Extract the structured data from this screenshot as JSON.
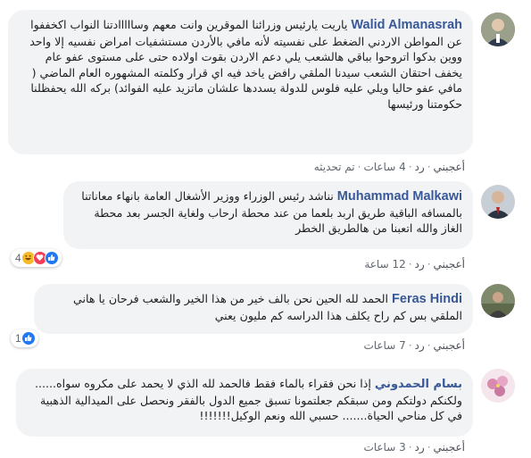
{
  "comments": [
    {
      "author": "Walid Almanasrah",
      "text": "ياريت يارئيس وزرائنا الموقرين وانت معهم وسااااادتنا النواب اكخففوا عن المواطن الاردني الضغط على نفسيته لأنه مافي بالأردن مستشفيات امراض نفسيه إلا واحد ووين بدكوا اتروحوا بباقي هالشعب يلي دعم الاردن بقوت اولاده حتى على مستوى عفو عام يخفف احتقان الشعب سيدنا الملقي رافض ياخد فيه اي قرار وكلمته المشهوره العام الماضي ( مافي عفو حاليا ويلي عليه فلوس للدولة يسددها علشان ماتزيد عليه الفوائد) بركه الله يحفظلنا حكومتنا ورئيسها",
      "like": "أعجبني",
      "reply": "رد",
      "time": "4 ساعات",
      "edited": "تم تحديثه"
    },
    {
      "author": "Muhammad Malkawi",
      "text": "نناشد رئيس الوزراء ووزير الأشغال العامة بانهاء معاناتنا بالمسافه الباقية طريق اربد بلعما من عند محطة ارحاب ولغاية الجسر بعد محطة الغاز والله اتعبنا من هالطريق الخطر",
      "like": "أعجبني",
      "reply": "رد",
      "time": "12 ساعة",
      "reactions_count": "4"
    },
    {
      "author": "Feras Hindi",
      "text": "الحمد لله الحين نحن بالف خير من هذا الخير والشعب فرحان يا هاني الملقي بس كم راح يكلف هذا الدراسه كم مليون يعني",
      "like": "أعجبني",
      "reply": "رد",
      "time": "7 ساعات",
      "reactions_count": "1"
    },
    {
      "author": "بسام الحمدوني",
      "text": "إذا نحن فقراء بالماء فقط فالحمد لله الذي لا يحمد على مكروه سواه...... ولكنكم دولتكم ومن سبقكم جعلتمونا تسبق جميع الدول بالفقر ونحصل على الميدالية الذهبية في كل مناحي الحياة....... حسبي الله ونعم الوكيل!!!!!!!",
      "like": "أعجبني",
      "reply": "رد",
      "time": "3 ساعات"
    }
  ],
  "colors": {
    "link": "#385898",
    "bubble": "#f2f3f5",
    "like_blue": "#2078f4",
    "haha_yellow": "#f7b928",
    "love_red": "#f33e58"
  },
  "icons": [
    "like-reaction-icon",
    "love-reaction-icon",
    "haha-reaction-icon"
  ]
}
